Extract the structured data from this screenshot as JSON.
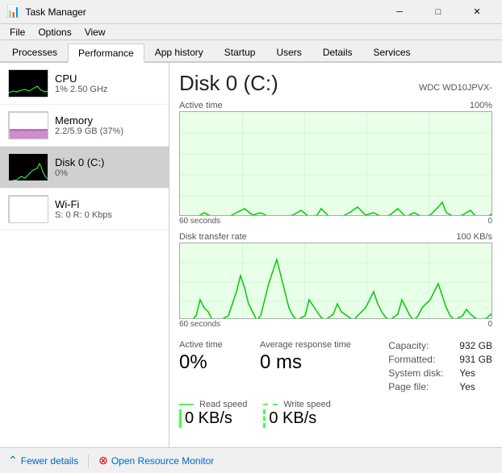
{
  "titleBar": {
    "icon": "⊞",
    "title": "Task Manager",
    "minimizeLabel": "─",
    "maximizeLabel": "□",
    "closeLabel": "✕"
  },
  "menuBar": {
    "items": [
      "File",
      "Options",
      "View"
    ]
  },
  "tabs": [
    {
      "label": "Processes",
      "active": false
    },
    {
      "label": "Performance",
      "active": true
    },
    {
      "label": "App history",
      "active": false
    },
    {
      "label": "Startup",
      "active": false
    },
    {
      "label": "Users",
      "active": false
    },
    {
      "label": "Details",
      "active": false
    },
    {
      "label": "Services",
      "active": false
    }
  ],
  "sidebar": {
    "items": [
      {
        "id": "cpu",
        "title": "CPU",
        "sub": "1% 2.50 GHz",
        "graphColor": "#44ff44",
        "active": false
      },
      {
        "id": "memory",
        "title": "Memory",
        "sub": "2.2/5.9 GB (37%)",
        "graphColor": "#aa44aa",
        "active": false
      },
      {
        "id": "disk",
        "title": "Disk 0 (C:)",
        "sub": "0%",
        "graphColor": "#44ff44",
        "active": true
      },
      {
        "id": "wifi",
        "title": "Wi-Fi",
        "sub": "S: 0 R: 0 Kbps",
        "graphColor": "#44ff44",
        "active": false
      }
    ]
  },
  "rightPanel": {
    "title": "Disk 0 (C:)",
    "subtitle": "WDC WD10JPVX-",
    "chart1": {
      "topLabel": "Active time",
      "topRight": "100%",
      "bottomLeft": "60 seconds",
      "bottomRight": "0"
    },
    "chart2": {
      "topLabel": "Disk transfer rate",
      "topRight": "100 KB/s",
      "bottomLeft": "60 seconds",
      "bottomRight": "0"
    },
    "stats": {
      "activeTime": {
        "label": "Active time",
        "value": "0%"
      },
      "responseTime": {
        "label": "Average response time",
        "value": "0 ms"
      },
      "readSpeed": {
        "label": "Read speed",
        "value": "0 KB/s",
        "lineColor": "#44ff44",
        "lineStyle": "solid"
      },
      "writeSpeed": {
        "label": "Write speed",
        "value": "0 KB/s",
        "lineColor": "#44ff44",
        "lineStyle": "dashed"
      }
    },
    "info": {
      "items": [
        {
          "key": "Capacity:",
          "value": "932 GB"
        },
        {
          "key": "Formatted:",
          "value": "931 GB"
        },
        {
          "key": "System disk:",
          "value": "Yes"
        },
        {
          "key": "Page file:",
          "value": "Yes"
        }
      ]
    }
  },
  "bottomBar": {
    "fewerDetails": "Fewer details",
    "openResourceMonitor": "Open Resource Monitor"
  }
}
